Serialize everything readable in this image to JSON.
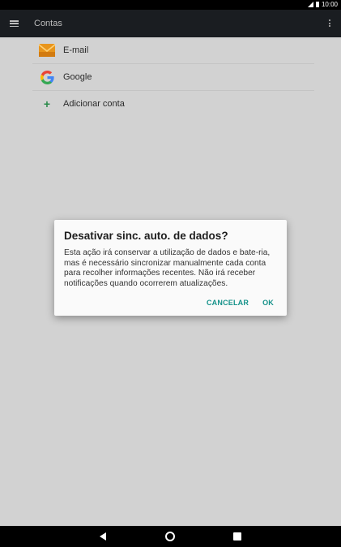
{
  "status_bar": {
    "time": "10:00"
  },
  "app_bar": {
    "title": "Contas"
  },
  "accounts": [
    {
      "label": "E-mail",
      "icon": "email-icon"
    },
    {
      "label": "Google",
      "icon": "google-icon"
    },
    {
      "label": "Adicionar conta",
      "icon": "plus-icon"
    }
  ],
  "dialog": {
    "title": "Desativar sinc. auto. de dados?",
    "body": "Esta ação irá conservar a utilização de dados e bate-ria, mas é necessário sincronizar manualmente cada conta para recolher informações recentes. Não irá receber notificações quando ocorrerem atualizações.",
    "cancel_label": "CANCELAR",
    "ok_label": "OK"
  },
  "colors": {
    "accent": "#15928a",
    "app_bar": "#1a1d21",
    "background": "#d2d2d2"
  }
}
